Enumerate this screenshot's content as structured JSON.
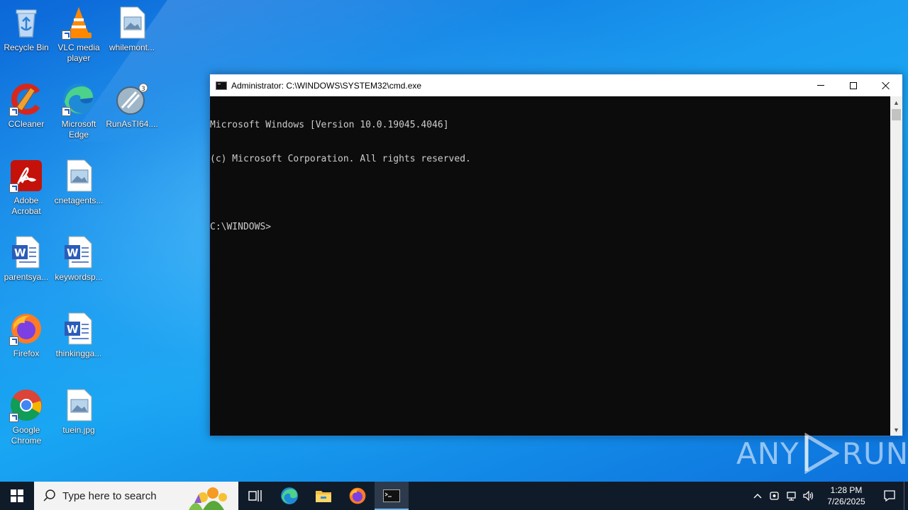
{
  "desktop": {
    "icons": [
      {
        "label": "Recycle Bin",
        "icon": "recycle-bin-icon"
      },
      {
        "label": "VLC media player",
        "icon": "vlc-icon"
      },
      {
        "label": "whilemont...",
        "icon": "image-file-icon"
      },
      {
        "label": "CCleaner",
        "icon": "ccleaner-icon"
      },
      {
        "label": "Microsoft Edge",
        "icon": "edge-icon"
      },
      {
        "label": "RunAsTI64....",
        "icon": "runasti-icon"
      },
      {
        "label": "Adobe Acrobat",
        "icon": "acrobat-icon"
      },
      {
        "label": "cnetagents...",
        "icon": "image-file-icon"
      },
      {
        "label": "parentsya...",
        "icon": "word-doc-icon"
      },
      {
        "label": "keywordsp...",
        "icon": "word-doc-icon"
      },
      {
        "label": "Firefox",
        "icon": "firefox-icon"
      },
      {
        "label": "thinkingga...",
        "icon": "word-doc-icon"
      },
      {
        "label": "Google Chrome",
        "icon": "chrome-icon"
      },
      {
        "label": "tuein.jpg",
        "icon": "image-file-icon"
      }
    ]
  },
  "cmd_window": {
    "title": "Administrator: C:\\WINDOWS\\SYSTEM32\\cmd.exe",
    "lines": [
      "Microsoft Windows [Version 10.0.19045.4046]",
      "(c) Microsoft Corporation. All rights reserved.",
      "",
      "C:\\WINDOWS>"
    ]
  },
  "watermark": {
    "left": "ANY",
    "right": "RUN"
  },
  "taskbar": {
    "search_placeholder": "Type here to search",
    "pinned": [
      "task-view-icon",
      "edge-icon",
      "file-explorer-icon",
      "firefox-icon",
      "cmd-icon"
    ],
    "clock_time": "1:28 PM",
    "clock_date": "7/26/2025"
  },
  "colors": {
    "console_bg": "#0c0c0c",
    "console_fg": "#cccccc",
    "taskbar_bg": "#101b2a"
  }
}
